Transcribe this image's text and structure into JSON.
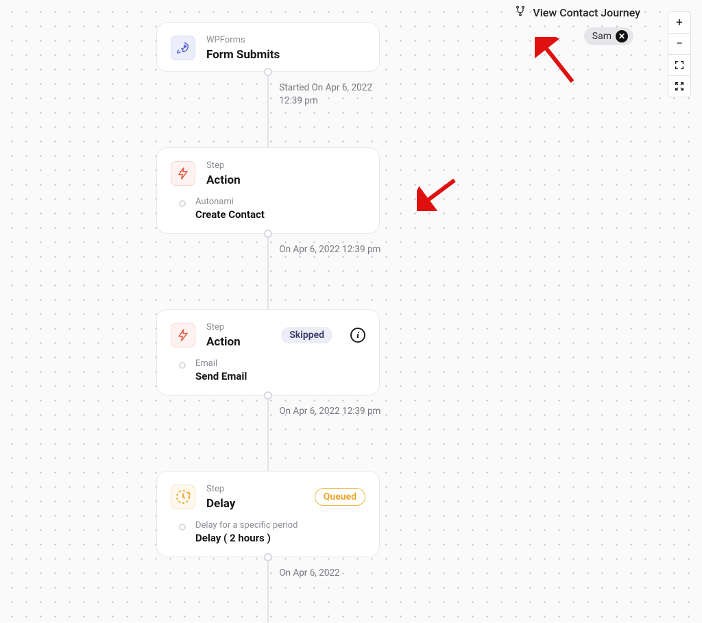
{
  "journey": {
    "label": "View Contact Journey",
    "contact_name": "Sam"
  },
  "timeline": [
    {
      "kind": "trigger",
      "icon_name": "rocket-icon",
      "icon_class": "icon-launch",
      "super": "WPForms",
      "title": "Form Submits",
      "timestamp": "Started On Apr 6, 2022 12:39 pm"
    },
    {
      "kind": "action",
      "icon_name": "bolt-icon",
      "icon_class": "icon-action",
      "super": "Step",
      "title": "Action",
      "body_super": "Autonami",
      "body_title": "Create Contact",
      "timestamp": "On Apr 6, 2022 12:39 pm"
    },
    {
      "kind": "action",
      "icon_name": "bolt-icon",
      "icon_class": "icon-action",
      "super": "Step",
      "title": "Action",
      "badge": {
        "text": "Skipped",
        "class": "badge-skipped"
      },
      "has_info": true,
      "body_super": "Email",
      "body_title": "Send Email",
      "timestamp": "On Apr 6, 2022 12:39 pm"
    },
    {
      "kind": "delay",
      "icon_name": "clock-icon",
      "icon_class": "icon-delay",
      "super": "Step",
      "title": "Delay",
      "badge": {
        "text": "Queued",
        "class": "badge-queued"
      },
      "body_super": "Delay for a specific period",
      "body_title": "Delay ( 2 hours )",
      "timestamp": "On Apr 6, 2022"
    }
  ]
}
